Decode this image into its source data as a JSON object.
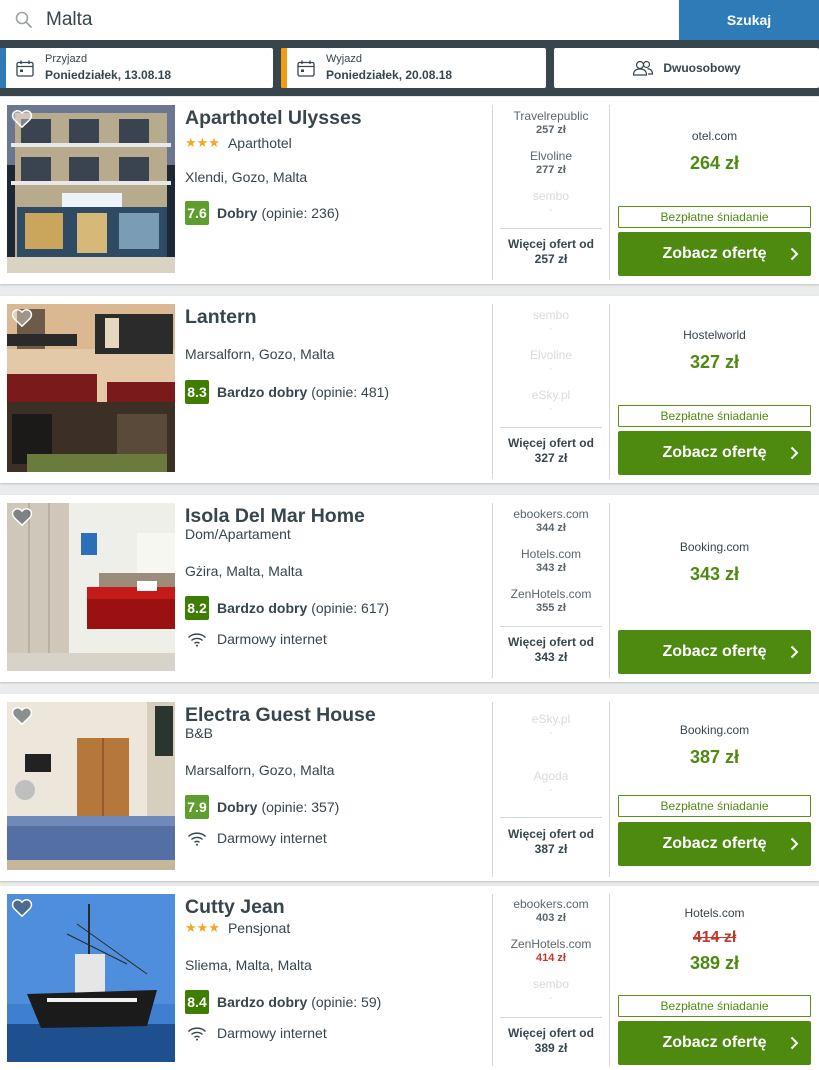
{
  "search": {
    "value": "Malta",
    "button_label": "Szukaj"
  },
  "dates": {
    "checkin": {
      "label": "Przyjazd",
      "value": "Poniedziałek, 13.08.18",
      "accent": "#2f7bb8"
    },
    "checkout": {
      "label": "Wyjazd",
      "value": "Poniedziałek, 20.08.18",
      "accent": "#f39c12"
    },
    "room": {
      "label": "Dwuosobowy"
    }
  },
  "colors": {
    "primary_green": "#4f8a10",
    "rating_good": "#5e9e2f",
    "rating_very_good": "#3f7d00",
    "search_blue": "#2f7bb8",
    "strike_red": "#c0392b"
  },
  "hotels": [
    {
      "name": "Aparthotel Ulysses",
      "stars": "★★★",
      "type": "Aparthotel",
      "location": "Xlendi, Gozo, Malta",
      "rating": {
        "score": "7.6",
        "label": "Dobry",
        "reviews": "(opinie: 236)"
      },
      "amenity": "",
      "offers": [
        {
          "provider": "Travelrepublic",
          "price": "257 zł"
        },
        {
          "provider": "Elvoline",
          "price": "277 zł"
        },
        {
          "provider": "sembo",
          "price": "-"
        }
      ],
      "more": {
        "label": "Więcej ofert od",
        "price": "257 zł"
      },
      "deal": {
        "provider": "otel.com",
        "price": "264 zł",
        "old_price": "",
        "breakfast": "Bezpłatne śniadanie",
        "cta": "Zobacz ofertę"
      }
    },
    {
      "name": "Lantern",
      "stars": "",
      "type": "",
      "location": "Marsalforn, Gozo, Malta",
      "rating": {
        "score": "8.3",
        "label": "Bardzo dobry",
        "reviews": "(opinie: 481)"
      },
      "amenity": "",
      "offers": [
        {
          "provider": "sembo",
          "price": "-"
        },
        {
          "provider": "Elvoline",
          "price": "-"
        },
        {
          "provider": "eSky.pl",
          "price": "-"
        }
      ],
      "more": {
        "label": "Więcej ofert od",
        "price": "327 zł"
      },
      "deal": {
        "provider": "Hostelworld",
        "price": "327 zł",
        "old_price": "",
        "breakfast": "Bezpłatne śniadanie",
        "cta": "Zobacz ofertę"
      }
    },
    {
      "name": "Isola Del Mar Home",
      "stars": "",
      "type": "Dom/Apartament",
      "location": "Gżira, Malta, Malta",
      "rating": {
        "score": "8.2",
        "label": "Bardzo dobry",
        "reviews": "(opinie: 617)"
      },
      "amenity": "Darmowy internet",
      "offers": [
        {
          "provider": "ebookers.com",
          "price": "344 zł"
        },
        {
          "provider": "Hotels.com",
          "price": "343 zł"
        },
        {
          "provider": "ZenHotels.com",
          "price": "355 zł"
        }
      ],
      "more": {
        "label": "Więcej ofert od",
        "price": "343 zł"
      },
      "deal": {
        "provider": "Booking.com",
        "price": "343 zł",
        "old_price": "",
        "breakfast": "",
        "cta": "Zobacz ofertę"
      }
    },
    {
      "name": "Electra Guest House",
      "stars": "",
      "type": "B&B",
      "location": "Marsalforn, Gozo, Malta",
      "rating": {
        "score": "7.9",
        "label": "Dobry",
        "reviews": "(opinie: 357)"
      },
      "amenity": "Darmowy internet",
      "offers": [
        {
          "provider": "eSky.pl",
          "price": "-"
        },
        {
          "provider": "Agoda",
          "price": "-"
        }
      ],
      "more": {
        "label": "Więcej ofert od",
        "price": "387 zł"
      },
      "deal": {
        "provider": "Booking.com",
        "price": "387 zł",
        "old_price": "",
        "breakfast": "Bezpłatne śniadanie",
        "cta": "Zobacz ofertę"
      }
    },
    {
      "name": "Cutty Jean",
      "stars": "★★★",
      "type": "Pensjonat",
      "location": "Sliema, Malta, Malta",
      "rating": {
        "score": "8.4",
        "label": "Bardzo dobry",
        "reviews": "(opinie: 59)"
      },
      "amenity": "Darmowy internet",
      "offers": [
        {
          "provider": "ebookers.com",
          "price": "403 zł"
        },
        {
          "provider": "ZenHotels.com",
          "price": "414 zł"
        },
        {
          "provider": "sembo",
          "price": "-"
        }
      ],
      "more": {
        "label": "Więcej ofert od",
        "price": "389 zł"
      },
      "deal": {
        "provider": "Hotels.com",
        "price": "389 zł",
        "old_price": "414 zł",
        "breakfast": "Bezpłatne śniadanie",
        "cta": "Zobacz ofertę"
      }
    }
  ]
}
